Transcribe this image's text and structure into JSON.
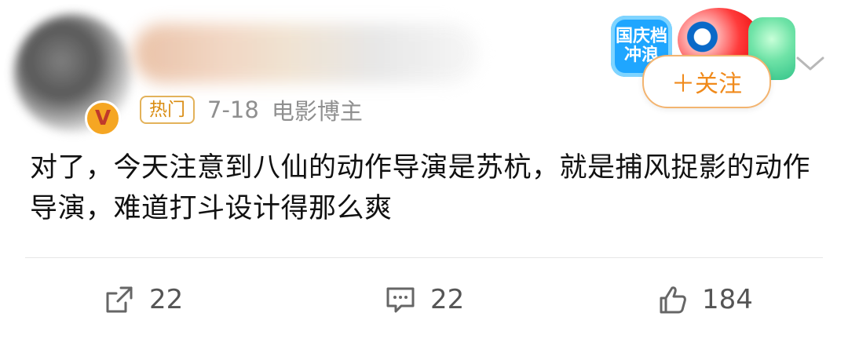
{
  "author": {
    "hot_badge": "热门",
    "date": "7-18",
    "role": "电影博主"
  },
  "promo": {
    "left_text_line1": "国庆档",
    "left_text_line2": "冲浪"
  },
  "follow": {
    "label": "＋关注"
  },
  "post": {
    "text": "对了，今天注意到八仙的动作导演是苏杭，就是捕风捉影的动作导演，难道打斗设计得那么爽"
  },
  "actions": {
    "repost_count": "22",
    "comment_count": "22",
    "like_count": "184"
  },
  "icons": {
    "repost": "share-icon",
    "comment": "comment-icon",
    "like": "thumbs-up-icon",
    "more": "chevron-down-icon"
  },
  "colors": {
    "accent_orange": "#f08a1b",
    "meta_gray": "#8f8f8f",
    "text": "#111111"
  }
}
